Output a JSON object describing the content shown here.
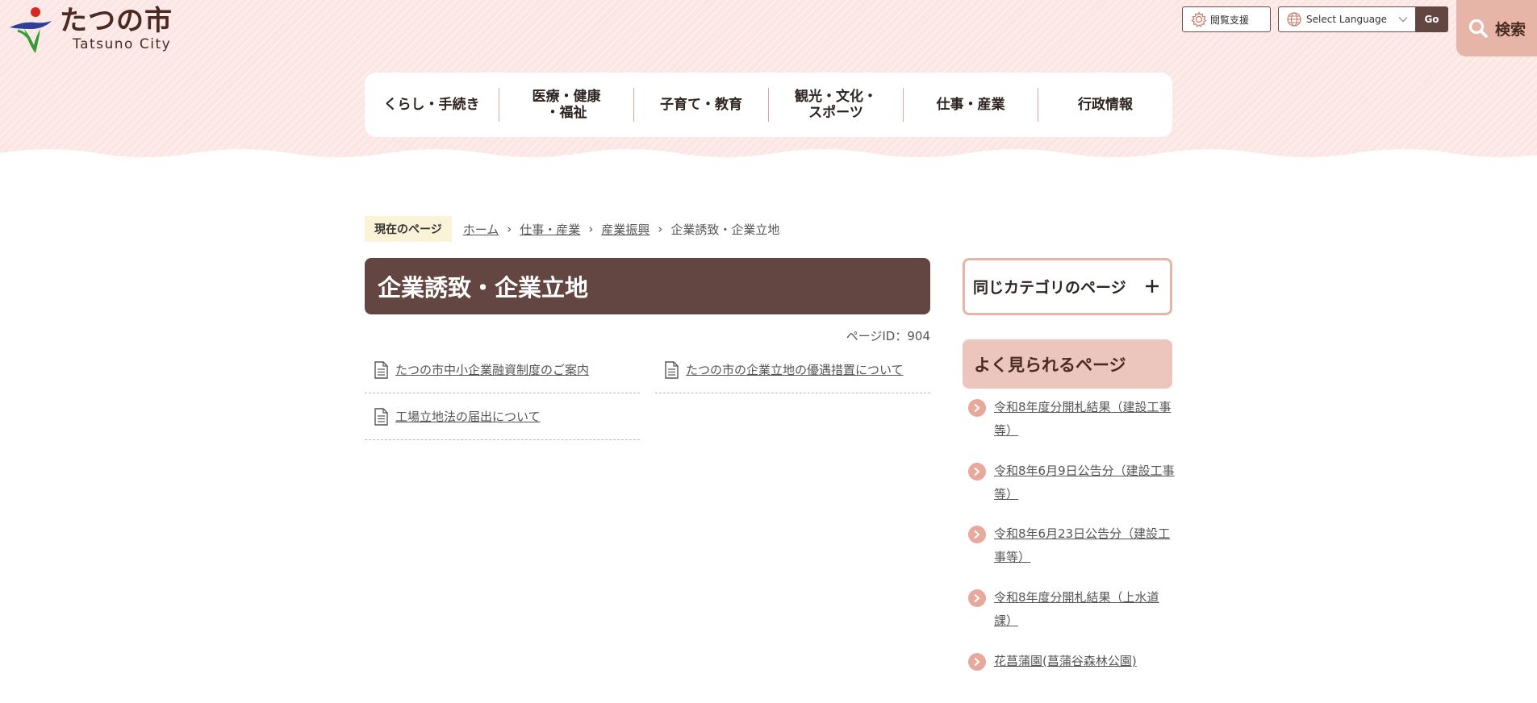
{
  "header": {
    "logo_text": "たつの市",
    "logo_subtext": "Tatsuno City",
    "accessibility_label": "閲覧支援",
    "language_select": "Select Language",
    "go_label": "Go",
    "search_label": "検索"
  },
  "nav": {
    "items": [
      {
        "label": "くらし・手続き"
      },
      {
        "label": "医療・健康\n・福祉"
      },
      {
        "label": "子育て・教育"
      },
      {
        "label": "観光・文化・\nスポーツ"
      },
      {
        "label": "仕事・産業"
      },
      {
        "label": "行政情報"
      }
    ]
  },
  "breadcrumb": {
    "label": "現在のページ",
    "items": [
      "ホーム",
      "仕事・産業",
      "産業振興"
    ],
    "current": "企業誘致・企業立地",
    "separator": "›"
  },
  "main": {
    "title": "企業誘致・企業立地",
    "page_id": "ページID：904",
    "links": [
      {
        "label": "たつの市中小企業融資制度のご案内"
      },
      {
        "label": "たつの市の企業立地の優遇措置について"
      },
      {
        "label": "工場立地法の届出について"
      }
    ]
  },
  "sidebar": {
    "same_category": "同じカテゴリのページ",
    "popular_title": "よく見られるページ",
    "popular": [
      {
        "label": "令和8年度分開札結果（建設工事等）"
      },
      {
        "label": "令和8年6月9日公告分（建設工事等）"
      },
      {
        "label": "令和8年6月23日公告分（建設工事等）"
      },
      {
        "label": "令和8年度分開札結果（上水道課）"
      },
      {
        "label": "花菖蒲園(菖蒲谷森林公園)"
      }
    ]
  },
  "colors": {
    "brand_brown": "#634541",
    "header_pink": "#fbe6e4",
    "accent_salmon": "#e6b5a8"
  }
}
